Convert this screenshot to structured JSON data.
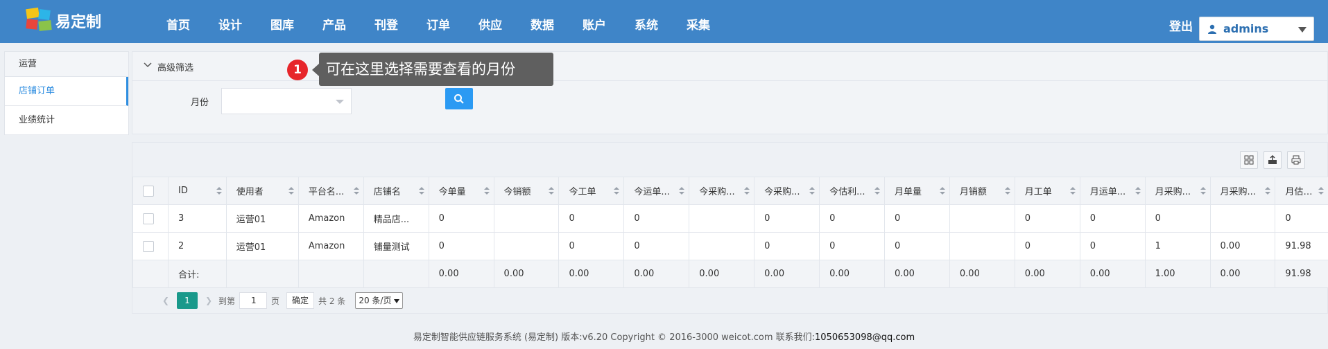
{
  "app": {
    "brand": "易定制",
    "nav": [
      "首页",
      "设计",
      "图库",
      "产品",
      "刊登",
      "订单",
      "供应",
      "数据",
      "账户",
      "系统",
      "采集"
    ],
    "logout_label": "登出",
    "user": "admins"
  },
  "sidebar": {
    "header": "运营",
    "items": [
      {
        "label": "店铺订单",
        "active": true
      },
      {
        "label": "业绩统计",
        "active": false
      }
    ]
  },
  "filter": {
    "title": "高级筛选",
    "month_label": "月份",
    "month_value": ""
  },
  "tooltip": {
    "badge": "1",
    "text": "可在这里选择需要查看的月份"
  },
  "table": {
    "columns": [
      "ID",
      "使用者",
      "平台名...",
      "店铺名",
      "今单量",
      "今销额",
      "今工单",
      "今运单...",
      "今采购...",
      "今采购...",
      "今估利...",
      "月单量",
      "月销额",
      "月工单",
      "月运单...",
      "月采购...",
      "月采购...",
      "月估利..."
    ],
    "rows": [
      [
        "3",
        "运营01",
        "Amazon",
        "精品店...",
        "0",
        "",
        "0",
        "0",
        "",
        "0",
        "0",
        "0",
        "",
        "0",
        "0",
        "0",
        "",
        "0"
      ],
      [
        "2",
        "运营01",
        "Amazon",
        "铺量测试",
        "0",
        "",
        "0",
        "0",
        "",
        "0",
        "0",
        "0",
        "",
        "0",
        "0",
        "1",
        "0.00",
        "91.98"
      ]
    ],
    "total_label": "合计:",
    "totals": [
      "",
      "",
      "",
      "0.00",
      "0.00",
      "0.00",
      "0.00",
      "0.00",
      "0.00",
      "0.00",
      "0.00",
      "0.00",
      "0.00",
      "0.00",
      "1.00",
      "0.00",
      "91.98"
    ]
  },
  "pager": {
    "current_page": "1",
    "goto_label": "到第",
    "goto_value": "1",
    "page_unit": "页",
    "confirm_label": "确定",
    "total_text": "共 2 条",
    "page_size": "20 条/页"
  },
  "footer": {
    "text": "易定制智能供应链服务系统 (易定制) 版本:v6.20 Copyright © 2016-3000 weicot.com 联系我们:",
    "contact": "1050653098@qq.com"
  },
  "colors": {
    "topbar": "#3f85c8",
    "accent": "#2f8ee0",
    "pager_active": "#19998b",
    "badge": "#e7262b",
    "tooltip": "#5f5f5f"
  }
}
